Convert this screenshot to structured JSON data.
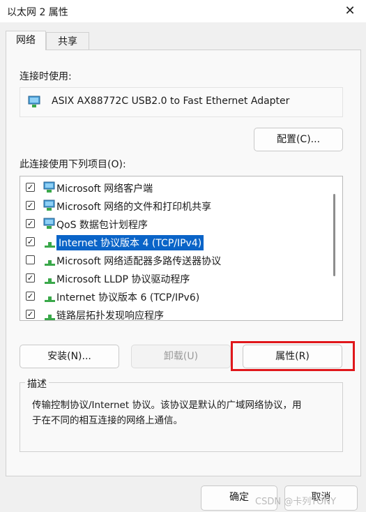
{
  "window": {
    "title": "以太网 2 属性",
    "close_glyph": "✕"
  },
  "tabs": [
    {
      "label": "网络",
      "active": true
    },
    {
      "label": "共享",
      "active": false
    }
  ],
  "connect_using": {
    "label": "连接时使用:",
    "adapter": "ASIX AX88772C USB2.0 to Fast Ethernet Adapter",
    "configure_button": "配置(C)..."
  },
  "items_section": {
    "label": "此连接使用下列项目(O):",
    "items": [
      {
        "label": "Microsoft 网络客户端",
        "checked": true,
        "icon": "network-client-icon"
      },
      {
        "label": "Microsoft 网络的文件和打印机共享",
        "checked": true,
        "icon": "network-client-icon"
      },
      {
        "label": "QoS 数据包计划程序",
        "checked": true,
        "icon": "network-client-icon"
      },
      {
        "label": "Internet 协议版本 4 (TCP/IPv4)",
        "checked": true,
        "icon": "protocol-icon",
        "selected": true
      },
      {
        "label": "Microsoft 网络适配器多路传送器协议",
        "checked": false,
        "icon": "protocol-icon"
      },
      {
        "label": "Microsoft LLDP 协议驱动程序",
        "checked": true,
        "icon": "protocol-icon"
      },
      {
        "label": "Internet 协议版本 6 (TCP/IPv6)",
        "checked": true,
        "icon": "protocol-icon"
      },
      {
        "label": "链路层拓扑发现响应程序",
        "checked": true,
        "icon": "protocol-icon"
      }
    ]
  },
  "buttons": {
    "install": "安装(N)...",
    "uninstall": "卸载(U)",
    "properties": "属性(R)",
    "ok": "确定",
    "cancel": "取消"
  },
  "description": {
    "title": "描述",
    "line1": "传输控制协议/Internet 协议。该协议是默认的广域网络协议，用",
    "line2": "于在不同的相互连接的网络上通信。"
  },
  "watermark": "CSDN @卡列TONY",
  "colors": {
    "selection": "#0a64c8",
    "highlight_box": "#e0171b",
    "primary_border": "#1f5fbf"
  }
}
